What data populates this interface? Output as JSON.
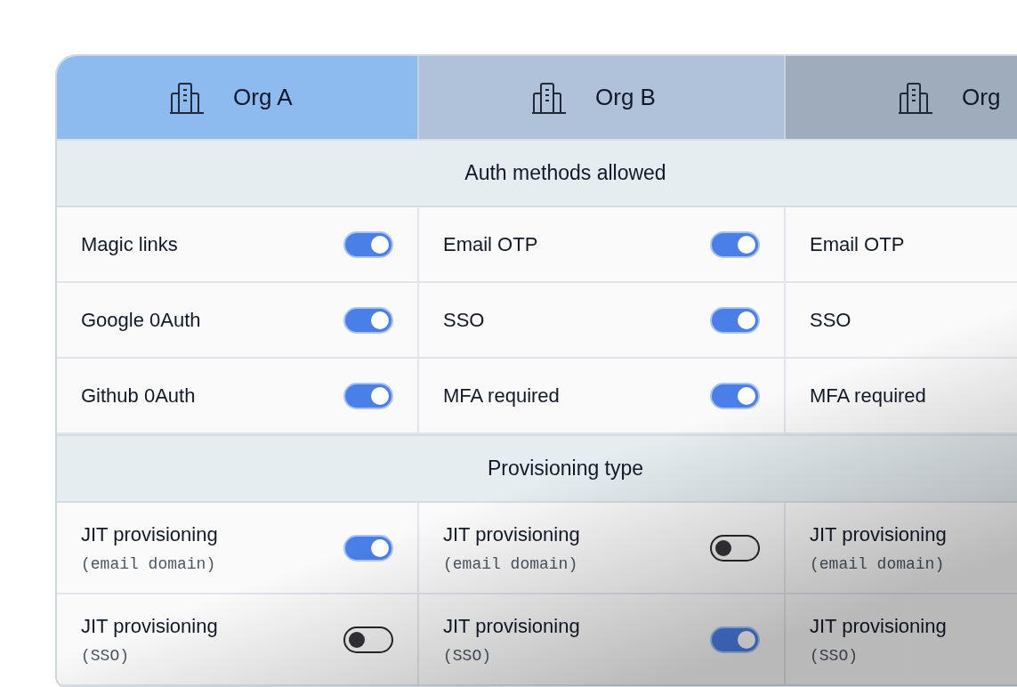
{
  "orgs": [
    {
      "name": "Org A",
      "color": "#8ebbef"
    },
    {
      "name": "Org B",
      "color": "#afc2da"
    },
    {
      "name": "Org",
      "color": "#9eacbb"
    }
  ],
  "sections": [
    {
      "title": "Auth methods allowed",
      "rows": [
        {
          "cells": [
            {
              "label": "Magic links",
              "on": true
            },
            {
              "label": "Email OTP",
              "on": true
            },
            {
              "label": "Email OTP"
            }
          ]
        },
        {
          "cells": [
            {
              "label": "Google 0Auth",
              "on": true
            },
            {
              "label": "SSO",
              "on": true
            },
            {
              "label": "SSO"
            }
          ]
        },
        {
          "cells": [
            {
              "label": "Github 0Auth",
              "on": true
            },
            {
              "label": "MFA required",
              "on": true
            },
            {
              "label": "MFA required"
            }
          ]
        }
      ]
    },
    {
      "title": "Provisioning type",
      "rows": [
        {
          "cells": [
            {
              "label": "JIT provisioning",
              "sublabel": "(email domain)",
              "on": true
            },
            {
              "label": "JIT provisioning",
              "sublabel": "(email domain)",
              "on": false
            },
            {
              "label": "JIT provisioning",
              "sublabel": "(email domain)"
            }
          ]
        },
        {
          "cells": [
            {
              "label": "JIT provisioning",
              "sublabel": "(SSO)",
              "on": false
            },
            {
              "label": "JIT provisioning",
              "sublabel": "(SSO)",
              "on": true
            },
            {
              "label": "JIT provisioning",
              "sublabel": "(SSO)"
            }
          ]
        }
      ]
    }
  ]
}
